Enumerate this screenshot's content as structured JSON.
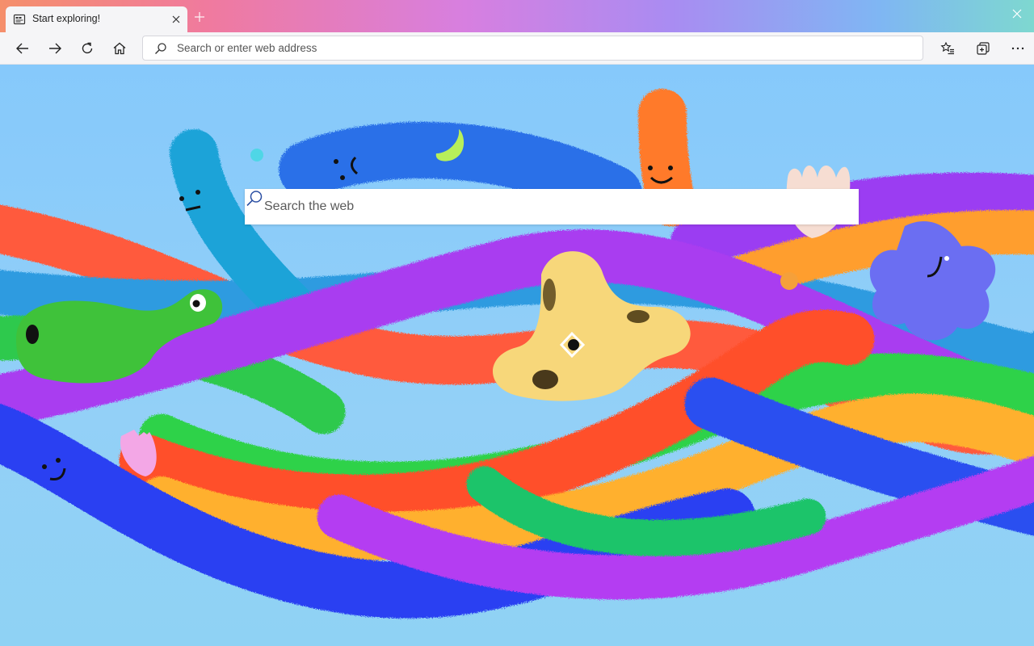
{
  "tab": {
    "title": "Start exploring!",
    "favicon": "new-tab-page-icon"
  },
  "toolbar": {
    "icons": [
      "back-arrow-icon",
      "forward-arrow-icon",
      "refresh-icon",
      "home-icon",
      "favorites-icon",
      "collections-icon",
      "more-options-icon"
    ]
  },
  "address_bar": {
    "placeholder": "Search or enter web address",
    "value": ""
  },
  "web_search": {
    "placeholder": "Search the web",
    "value": ""
  },
  "colors": {
    "tab_strip_gradient": [
      "#f58f6b",
      "#d77fe0",
      "#7fb6f3",
      "#7ed8d0"
    ],
    "toolbar_bg": "#f5f5f7",
    "page_bg": "#8ecbf5"
  }
}
